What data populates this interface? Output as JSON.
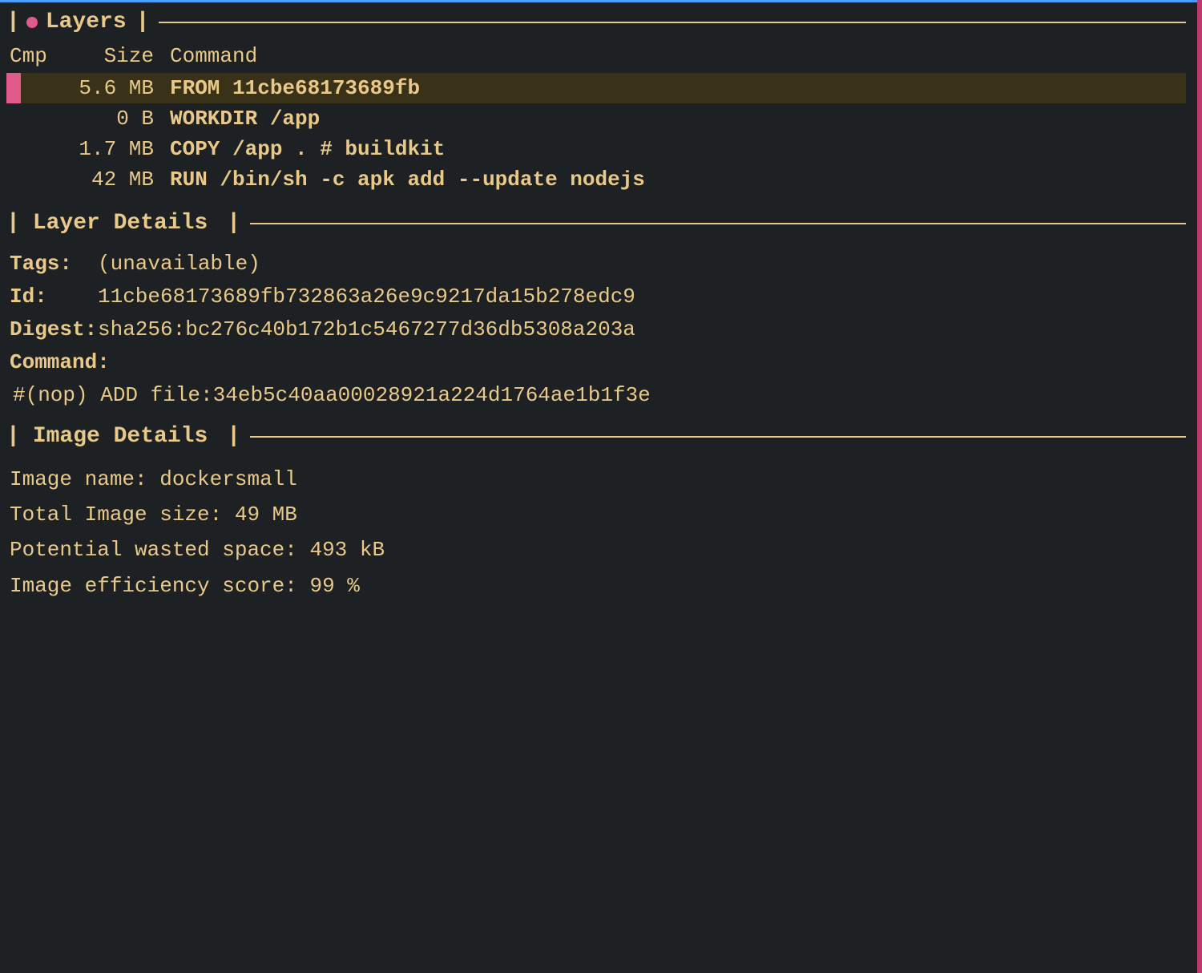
{
  "topBorder": {
    "color": "#4a9eff"
  },
  "rightBorder": {
    "color": "#c0396e"
  },
  "sections": {
    "layers": {
      "title": "Layers",
      "hasDot": true,
      "columns": {
        "cmp": "Cmp",
        "size": "Size",
        "command": "Command"
      },
      "rows": [
        {
          "cmp": "",
          "size": "5.6 MB",
          "command": "FROM 11cbe68173689fb",
          "selected": true
        },
        {
          "cmp": "",
          "size": "0 B",
          "command": "WORKDIR /app",
          "selected": false
        },
        {
          "cmp": "",
          "size": "1.7 MB",
          "command": "COPY /app . # buildkit",
          "selected": false
        },
        {
          "cmp": "",
          "size": "42 MB",
          "command": "RUN /bin/sh -c apk add --update nodejs",
          "selected": false
        }
      ]
    },
    "layerDetails": {
      "title": "Layer Details",
      "tags": {
        "label": "Tags:",
        "value": "(unavailable)"
      },
      "id": {
        "label": "Id:",
        "value": "11cbe68173689fb732863a26e9c9217da15b278edc9"
      },
      "digest": {
        "label": "Digest:",
        "value": "sha256:bc276c40b172b1c5467277d36db5308a203a"
      },
      "command": {
        "label": "Command:",
        "value": "#(nop) ADD file:34eb5c40aa00028921a224d1764ae1b1f3e"
      }
    },
    "imageDetails": {
      "title": "Image Details",
      "imageName": {
        "label": "Image name:",
        "value": "dockersmall"
      },
      "totalSize": {
        "label": "Total Image size:",
        "value": "49 MB"
      },
      "wastedSpace": {
        "label": "Potential wasted space:",
        "value": "493 kB"
      },
      "efficiency": {
        "label": "Image efficiency score:",
        "value": "99 %"
      }
    }
  }
}
